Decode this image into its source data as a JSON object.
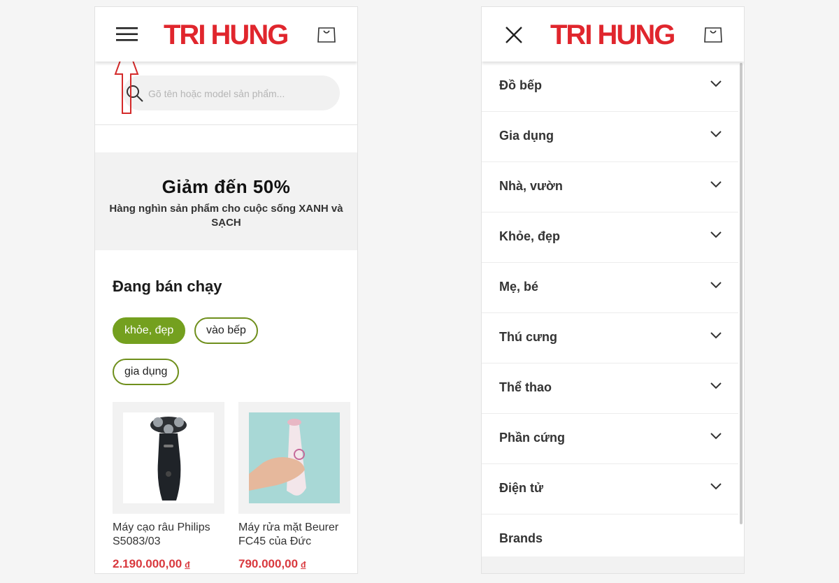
{
  "brand": {
    "logo_text": "TRI HUNG",
    "logo_color": "#e0262d"
  },
  "left_screen": {
    "search": {
      "placeholder": "Gõ tên hoặc model sản phẩm..."
    },
    "promo": {
      "headline": "Giảm đến 50%",
      "subtext": "Hàng nghìn sản phẩm cho cuộc sống XANH và SẠCH"
    },
    "bestsellers": {
      "title": "Đang bán chạy",
      "chips": [
        "khỏe, đẹp",
        "vào bếp",
        "gia dụng"
      ],
      "active_chip": "khỏe, đẹp"
    },
    "products": [
      {
        "name": "Máy cạo râu Philips S5083/03",
        "price": "2.190.000,00",
        "currency": "đ"
      },
      {
        "name": "Máy rửa mặt Beurer FC45 của Đức",
        "price": "790.000,00",
        "currency": "đ"
      }
    ]
  },
  "right_screen": {
    "menu_items": [
      {
        "label": "Đồ bếp",
        "has_submenu": true
      },
      {
        "label": "Gia dụng",
        "has_submenu": true
      },
      {
        "label": "Nhà, vườn",
        "has_submenu": true
      },
      {
        "label": "Khỏe, đẹp",
        "has_submenu": true
      },
      {
        "label": "Mẹ, bé",
        "has_submenu": true
      },
      {
        "label": "Thú cưng",
        "has_submenu": true
      },
      {
        "label": "Thể thao",
        "has_submenu": true
      },
      {
        "label": "Phần cứng",
        "has_submenu": true
      },
      {
        "label": "Điện tử",
        "has_submenu": true
      },
      {
        "label": "Brands",
        "has_submenu": false
      }
    ]
  },
  "icons": {
    "left_menu": "hamburger-icon",
    "right_close": "close-icon",
    "cart": "shopping-bag-icon",
    "search": "search-icon",
    "chevron": "chevron-down-icon",
    "annotation": "up-arrow-annotation"
  },
  "colors": {
    "accent_green": "#74a01f",
    "price_red": "#d9393e",
    "annotation_red": "#d42a2a"
  }
}
